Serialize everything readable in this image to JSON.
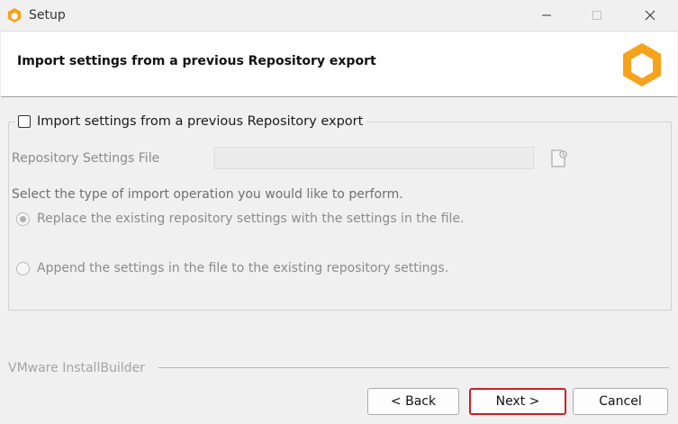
{
  "window": {
    "title": "Setup",
    "controls": [
      "minimize-icon",
      "maximize-icon",
      "close-icon"
    ]
  },
  "header": {
    "title": "Import settings from a previous Repository export",
    "logo": "installbuilder-cube-logo",
    "accent_color": "#f7a21b"
  },
  "import_section": {
    "checkbox_label": "Import settings from a previous Repository export",
    "checked": false,
    "file_label": "Repository Settings File",
    "file_value": "",
    "browse_icon": "browse-file-icon",
    "prompt": "Select the type of import operation you would like to perform.",
    "options": [
      {
        "label": "Replace the existing repository settings with the settings in the file.",
        "selected": true
      },
      {
        "label": "Append the settings in the file to the existing repository settings.",
        "selected": false
      }
    ]
  },
  "footer": {
    "brand": "VMware InstallBuilder",
    "back_label": "< Back",
    "next_label": "Next >",
    "cancel_label": "Cancel",
    "focus_color": "#c8202a"
  }
}
